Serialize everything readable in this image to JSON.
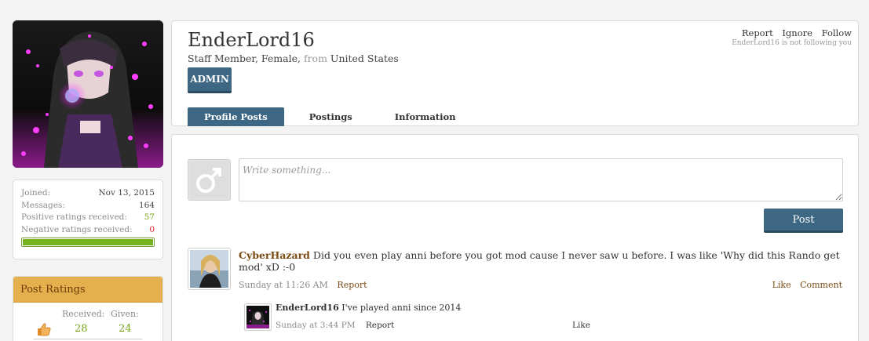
{
  "sidebar": {
    "stats": [
      {
        "label": "Joined:",
        "value": "Nov 13, 2015",
        "kind": "plain"
      },
      {
        "label": "Messages:",
        "value": "164",
        "kind": "plain"
      },
      {
        "label": "Positive ratings received:",
        "value": "57",
        "kind": "pos"
      },
      {
        "label": "Negative ratings received:",
        "value": "0",
        "kind": "neg"
      }
    ],
    "rating_bar_fraction": 1.0,
    "post_ratings": {
      "title": "Post Ratings",
      "received_label": "Received:",
      "given_label": "Given:",
      "received": "28",
      "given": "24"
    }
  },
  "profile": {
    "username": "EnderLord16",
    "role": "Staff Member, Female,",
    "from_label": "from",
    "location": "United States",
    "badge": "ADMIN",
    "actions": {
      "report": "Report",
      "ignore": "Ignore",
      "follow": "Follow"
    },
    "follow_status": "EnderLord16 is not following you",
    "tabs": [
      "Profile Posts",
      "Postings",
      "Information"
    ]
  },
  "composer": {
    "placeholder": "Write something...",
    "post_label": "Post"
  },
  "comment": {
    "author": "CyberHazard",
    "text": "Did you even play anni before you got mod cause I never saw u before. I was like 'Why did this Rando get mod' xD :-0",
    "time": "Sunday at 11:26 AM",
    "report": "Report",
    "like": "Like",
    "comment": "Comment"
  },
  "reply": {
    "author": "EnderLord16",
    "text": "I've played anni since 2014",
    "time": "Sunday at 3:44 PM",
    "report": "Report",
    "like": "Like"
  },
  "colors": {
    "accent": "#3e6784",
    "ratings_header": "#e4b04d",
    "positive": "#7aa51a",
    "negative": "#dd2222",
    "link": "#7a4a10"
  }
}
